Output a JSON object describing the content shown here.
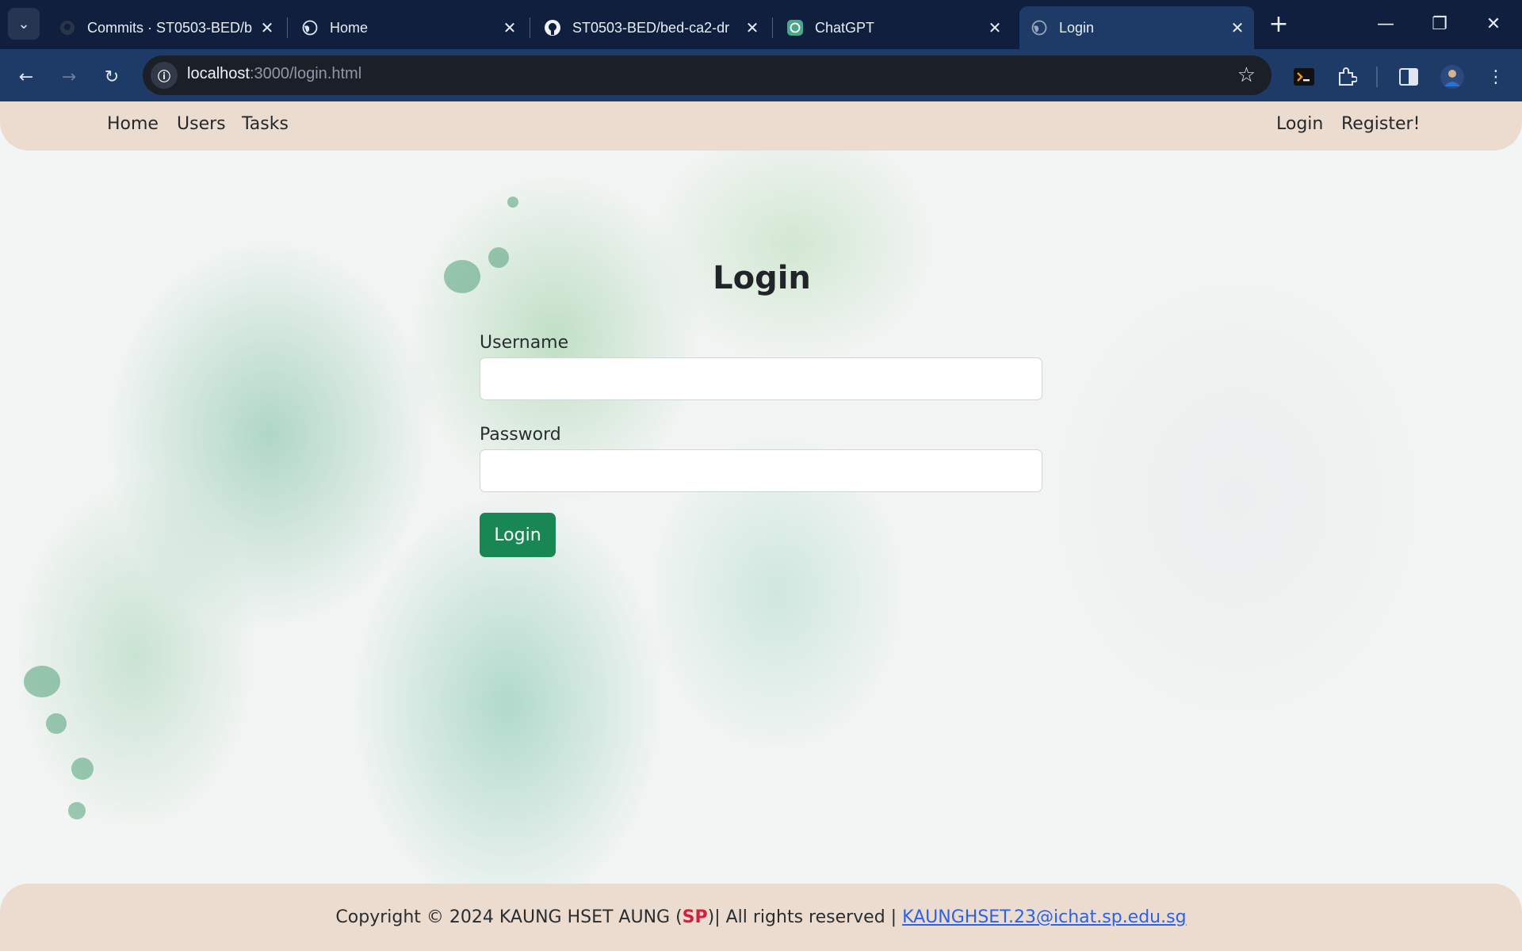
{
  "browser": {
    "tabs": [
      {
        "title": "Commits · ST0503-BED/b",
        "favicon": "github-icon",
        "active": false
      },
      {
        "title": "Home",
        "favicon": "globe-icon",
        "active": false
      },
      {
        "title": "ST0503-BED/bed-ca2-dr",
        "favicon": "github-icon",
        "active": false
      },
      {
        "title": "ChatGPT",
        "favicon": "chatgpt-icon",
        "active": false
      },
      {
        "title": "Login",
        "favicon": "globe-icon",
        "active": true
      }
    ],
    "url_host": "localhost",
    "url_rest": ":3000/login.html"
  },
  "navbar": {
    "left_links": [
      "Home",
      "Users",
      "Tasks"
    ],
    "right_links": [
      "Login",
      "Register!"
    ]
  },
  "login_form": {
    "title": "Login",
    "username_label": "Username",
    "username_value": "",
    "password_label": "Password",
    "password_value": "",
    "submit_label": "Login"
  },
  "footer": {
    "prefix": "Copyright © 2024 KAUNG HSET AUNG (",
    "sp": "SP",
    "middle": ")| All rights reserved | ",
    "email": "KAUNGHSET.23@ichat.sp.edu.sg"
  },
  "colors": {
    "navbar_bg": "#ecdccf",
    "button_green": "#198754",
    "footer_sp_red": "#d11f3c",
    "link_blue": "#2a62e8",
    "chrome_dark": "#0f1f3d",
    "chrome_toolbar": "#1e3a66"
  }
}
